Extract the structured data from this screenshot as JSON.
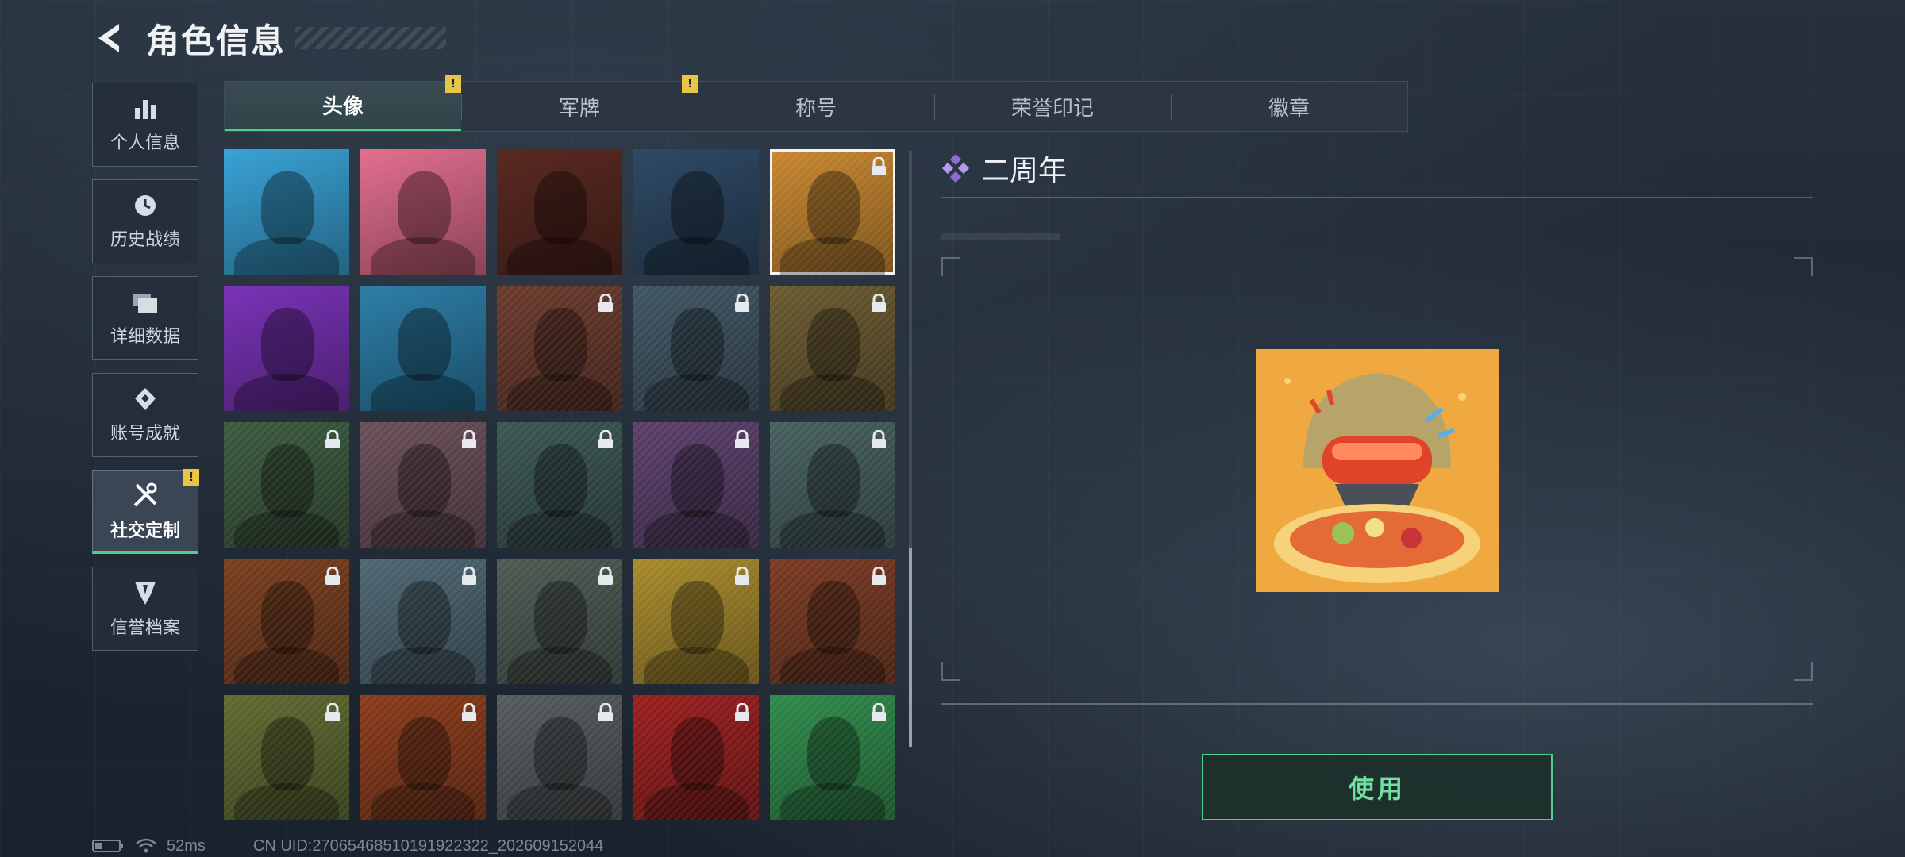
{
  "header": {
    "title": "角色信息"
  },
  "nav": {
    "items": [
      {
        "label": "个人信息",
        "icon": "bar-chart-icon"
      },
      {
        "label": "历史战绩",
        "icon": "history-clock-icon"
      },
      {
        "label": "详细数据",
        "icon": "folders-icon"
      },
      {
        "label": "账号成就",
        "icon": "achievement-icon"
      },
      {
        "label": "社交定制",
        "icon": "tools-icon",
        "active": true,
        "badge": "!"
      },
      {
        "label": "信誉档案",
        "icon": "credit-shield-icon"
      }
    ]
  },
  "tabs": [
    {
      "label": "头像",
      "active": true,
      "badge": "!"
    },
    {
      "label": "军牌",
      "badge": "!"
    },
    {
      "label": "称号"
    },
    {
      "label": "荣誉印记"
    },
    {
      "label": "徽章"
    }
  ],
  "avatars": [
    {
      "color": "#3aa3d6",
      "locked": false
    },
    {
      "color": "#e36f8f",
      "locked": false
    },
    {
      "color": "#5a2a22",
      "locked": false
    },
    {
      "color": "#2f4a66",
      "locked": false
    },
    {
      "color": "#c9872e",
      "locked": true,
      "selected": true
    },
    {
      "color": "#7a34b8",
      "locked": false
    },
    {
      "color": "#2d7fa8",
      "locked": false
    },
    {
      "color": "#6b3a2c",
      "locked": true
    },
    {
      "color": "#3f5563",
      "locked": true
    },
    {
      "color": "#6b5a30",
      "locked": true
    },
    {
      "color": "#3b5a3e",
      "locked": true
    },
    {
      "color": "#6a4e58",
      "locked": true
    },
    {
      "color": "#3a5653",
      "locked": true
    },
    {
      "color": "#5b3f6b",
      "locked": true
    },
    {
      "color": "#46605f",
      "locked": true
    },
    {
      "color": "#7a3e1e",
      "locked": true
    },
    {
      "color": "#4d6672",
      "locked": true
    },
    {
      "color": "#4c5a52",
      "locked": true
    },
    {
      "color": "#a88a2a",
      "locked": true
    },
    {
      "color": "#7a3a22",
      "locked": true
    },
    {
      "color": "#5e6a30",
      "locked": true
    },
    {
      "color": "#8a3a1a",
      "locked": true
    },
    {
      "color": "#555a5e",
      "locked": true
    },
    {
      "color": "#9a1e1e",
      "locked": true
    },
    {
      "color": "#2e8a4a",
      "locked": true
    }
  ],
  "detail": {
    "title": "二周年",
    "preview_color": "#e8a43a",
    "use_label": "使用"
  },
  "status": {
    "ping": "52ms",
    "uid": "CN UID:27065468510191922322_202609152044"
  },
  "colors": {
    "accent": "#4fd08a",
    "badge": "#e8c542",
    "diamond": "#8f6ad8"
  }
}
